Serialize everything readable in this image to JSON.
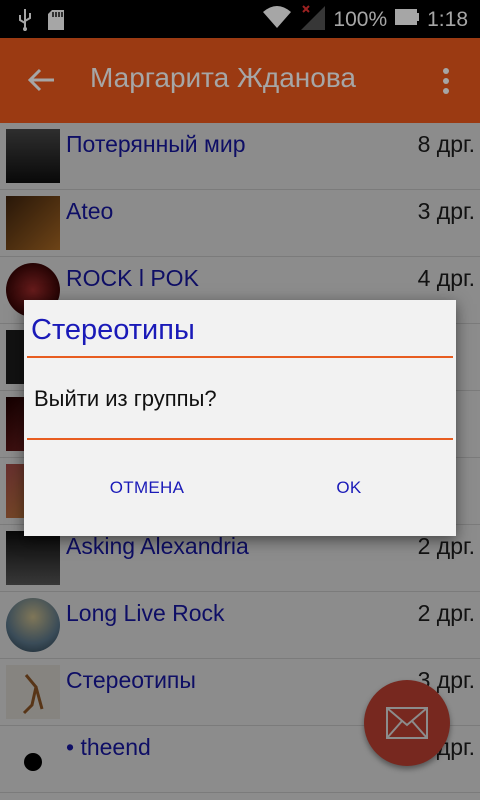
{
  "status_bar": {
    "battery": "100%",
    "time": "1:18"
  },
  "app_bar": {
    "title": "Маргарита Жданова"
  },
  "list": [
    {
      "name": "Потерянный мир",
      "count": "8 дрг."
    },
    {
      "name": "Ateo",
      "count": "3 дрг."
    },
    {
      "name": "ROCK l POK",
      "count": "4 дрг."
    },
    {
      "name": "",
      "count": ""
    },
    {
      "name": "",
      "count": ""
    },
    {
      "name": "",
      "count": ""
    },
    {
      "name": "Asking Alexandria",
      "count": "2 дрг."
    },
    {
      "name": "Long Live Rock",
      "count": "2 дрг."
    },
    {
      "name": "Стереотипы",
      "count": "3 дрг."
    },
    {
      "name": "• theend",
      "count": "7 дрг."
    }
  ],
  "dialog": {
    "title": "Стереотипы",
    "message": "Выйти из группы?",
    "cancel_label": "ОТМЕНА",
    "ok_label": "OK"
  },
  "colors": {
    "accent": "#ee5a1d",
    "link": "#1a1ab8",
    "fab": "#d94a3a"
  },
  "icons": [
    "usb-icon",
    "sd-card-icon",
    "wifi-icon",
    "signal-icon",
    "battery-icon",
    "back-arrow-icon",
    "overflow-menu-icon",
    "mail-icon"
  ]
}
